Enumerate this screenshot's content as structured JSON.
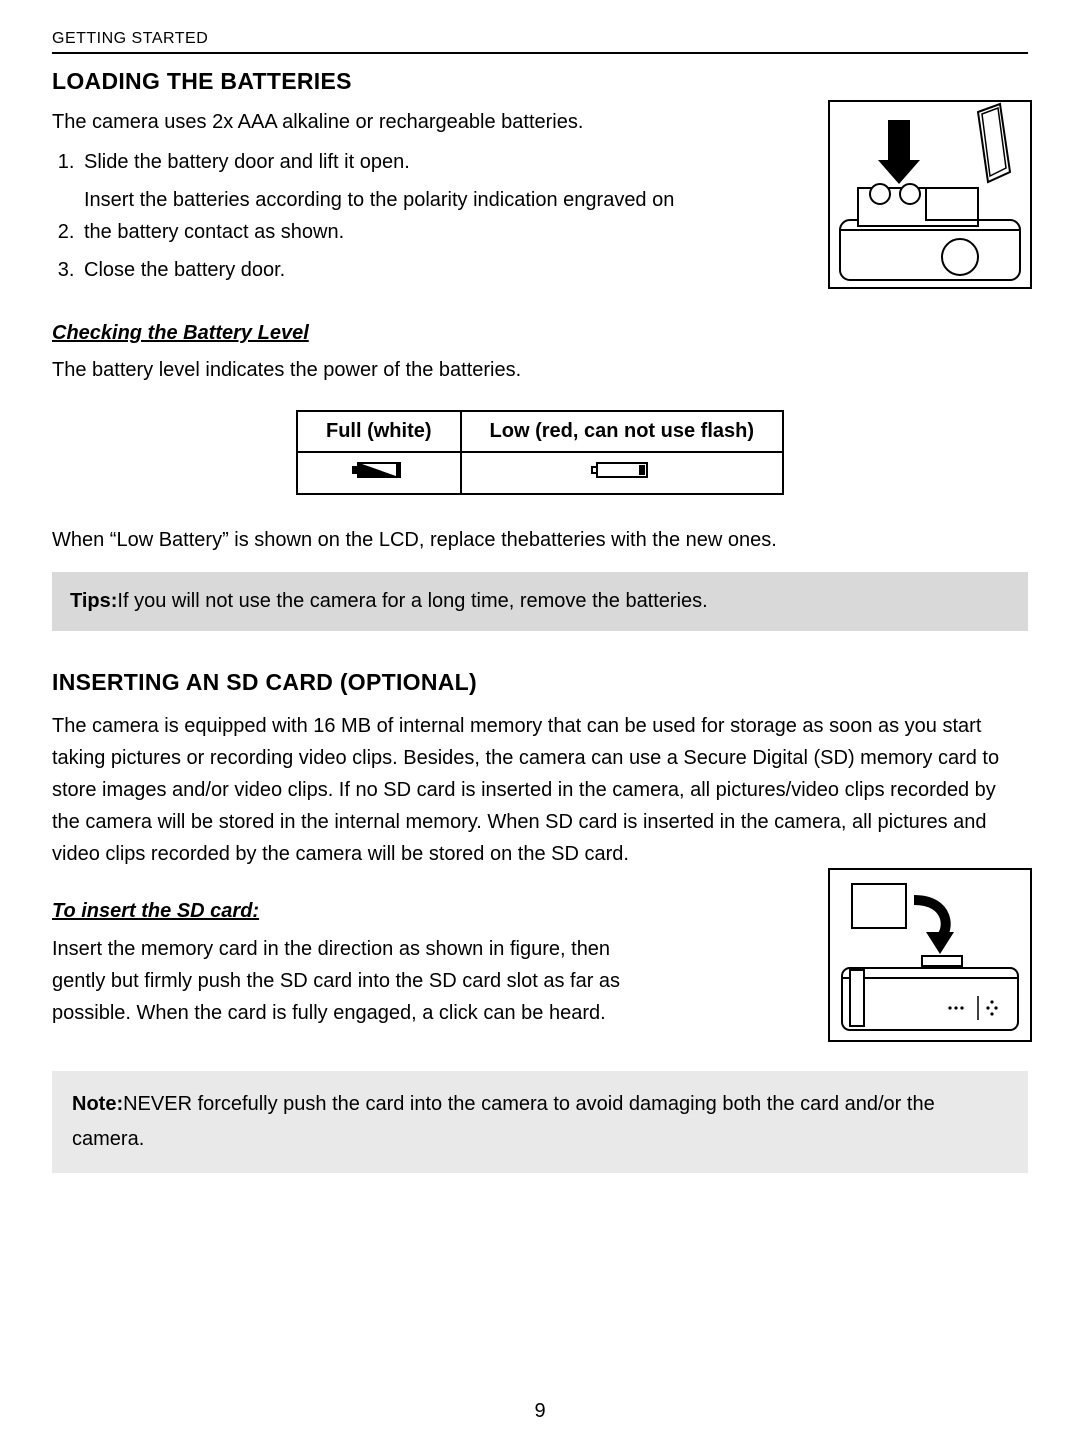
{
  "running_head": "GETTING STARTED",
  "page_number": "9",
  "section1": {
    "title": "LOADING THE BATTERIES",
    "intro": "The camera uses 2x AAA alkaline or rechargeable batteries.",
    "steps": [
      "Slide the battery door and lift it open.",
      "Insert the batteries according to the polarity indication engraved on the battery contact as shown.",
      "Close the battery door."
    ],
    "sub_title": "Checking the Battery Level",
    "sub_intro": "The battery level indicates the power of the batteries.",
    "table": {
      "col1": "Full (white)",
      "col2": "Low (red, can not use flash)"
    },
    "after_table": "When “Low Battery” is shown on the LCD,  replace thebatteries with the new ones.",
    "tip_label": "Tips:",
    "tip_text": "If you will not use the camera for a long time, remove the batteries."
  },
  "section2": {
    "title": "INSERTING AN SD CARD (OPTIONAL)",
    "body": "The camera is equipped with 16 MB of internal memory that can be used for storage as soon as you start taking pictures or recording video clips. Besides, the camera can use a Secure Digital (SD) memory card to store images and/or video clips. If no SD card is inserted in the camera, all pictures/video clips recorded by the camera will be stored in the internal memory. When SD card is inserted in the camera, all pictures and video clips recorded by the camera will be stored on the SD card.",
    "sub_title": "To insert the SD card:",
    "sub_body": "Insert the memory card in the direction as shown in figure, then gently but firmly push the SD card into the SD card slot as far as possible. When the card is fully engaged, a click can be heard.",
    "note_label": "Note:",
    "note_text": "NEVER forcefully push the card into the camera to avoid damaging both the card and/or the camera."
  }
}
